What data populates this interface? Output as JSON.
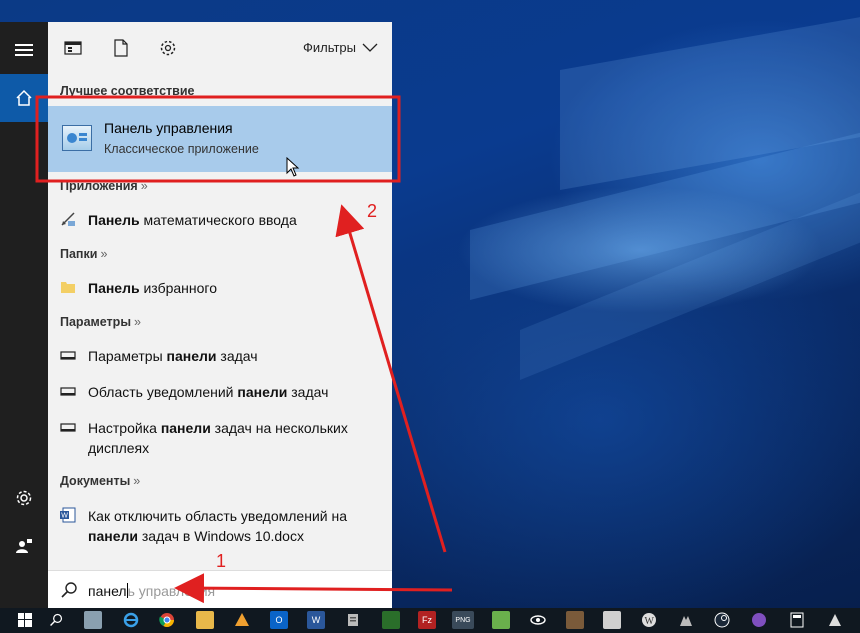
{
  "panel": {
    "filters_label": "Фильтры",
    "best_match_header": "Лучшее соответствие",
    "best_match": {
      "title": "Панель управления",
      "subtitle": "Классическое приложение"
    },
    "apps_header": "Приложения",
    "apps": [
      {
        "text_bold": "Панель",
        "text_rest": " математического ввода"
      }
    ],
    "folders_header": "Папки",
    "folders": [
      {
        "text_bold": "Панель",
        "text_rest": " избранного"
      }
    ],
    "settings_header": "Параметры",
    "settings": [
      {
        "pre": "Параметры ",
        "bold": "панели",
        "post": " задач"
      },
      {
        "pre": "Область уведомлений ",
        "bold": "панели",
        "post": " задач"
      },
      {
        "pre": "Настройка ",
        "bold": "панели",
        "post": " задач на нескольких дисплеях"
      }
    ],
    "documents_header": "Документы",
    "documents": [
      {
        "pre": "Как отключить область уведомлений на ",
        "bold": "панели",
        "post": " задач в Windows 10.docx"
      }
    ],
    "section_chevron": "»"
  },
  "search": {
    "typed": "панел",
    "typed_after_caret": "ь",
    "suggestion": " управления"
  },
  "annotations": {
    "step1": "1",
    "step2": "2",
    "color": "#e02020"
  },
  "taskbar": {
    "png_label": "PNG"
  }
}
